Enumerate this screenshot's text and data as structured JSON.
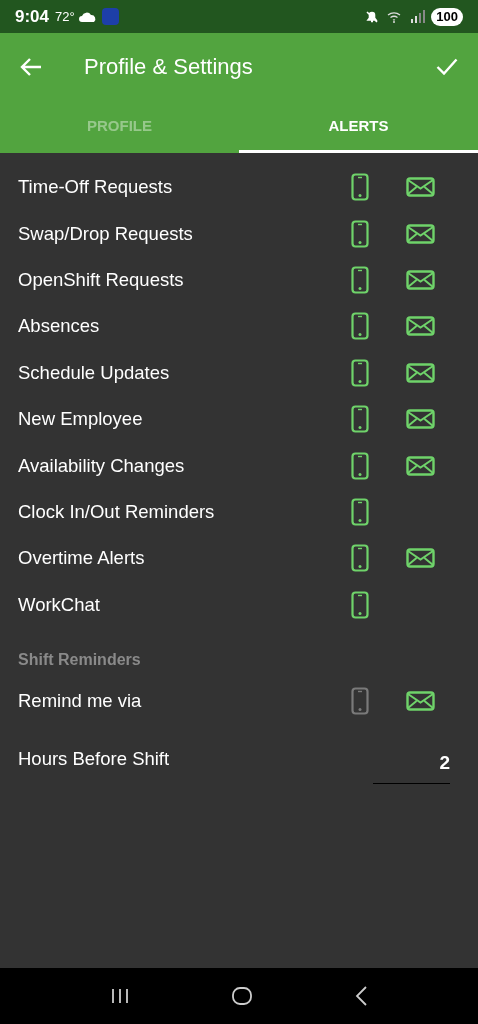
{
  "status_bar": {
    "time": "9:04",
    "temperature": "72°",
    "battery": "100"
  },
  "toolbar": {
    "title": "Profile & Settings"
  },
  "tabs": [
    {
      "label": "PROFILE",
      "selected": false
    },
    {
      "label": "ALERTS",
      "selected": true
    }
  ],
  "alerts": [
    {
      "label": "Time-Off Requests",
      "phone": true,
      "email": true
    },
    {
      "label": "Swap/Drop Requests",
      "phone": true,
      "email": true
    },
    {
      "label": "OpenShift Requests",
      "phone": true,
      "email": true
    },
    {
      "label": "Absences",
      "phone": true,
      "email": true
    },
    {
      "label": "Schedule Updates",
      "phone": true,
      "email": true
    },
    {
      "label": "New Employee",
      "phone": true,
      "email": true
    },
    {
      "label": "Availability Changes",
      "phone": true,
      "email": true
    },
    {
      "label": "Clock In/Out Reminders",
      "phone": true
    },
    {
      "label": "Overtime Alerts",
      "phone": true,
      "email": true
    },
    {
      "label": "WorkChat",
      "phone": true
    }
  ],
  "shift_reminders": {
    "heading": "Shift Reminders",
    "remind_label": "Remind me via",
    "phone": false,
    "email": true,
    "hours_label": "Hours Before Shift",
    "hours_value": "2"
  }
}
